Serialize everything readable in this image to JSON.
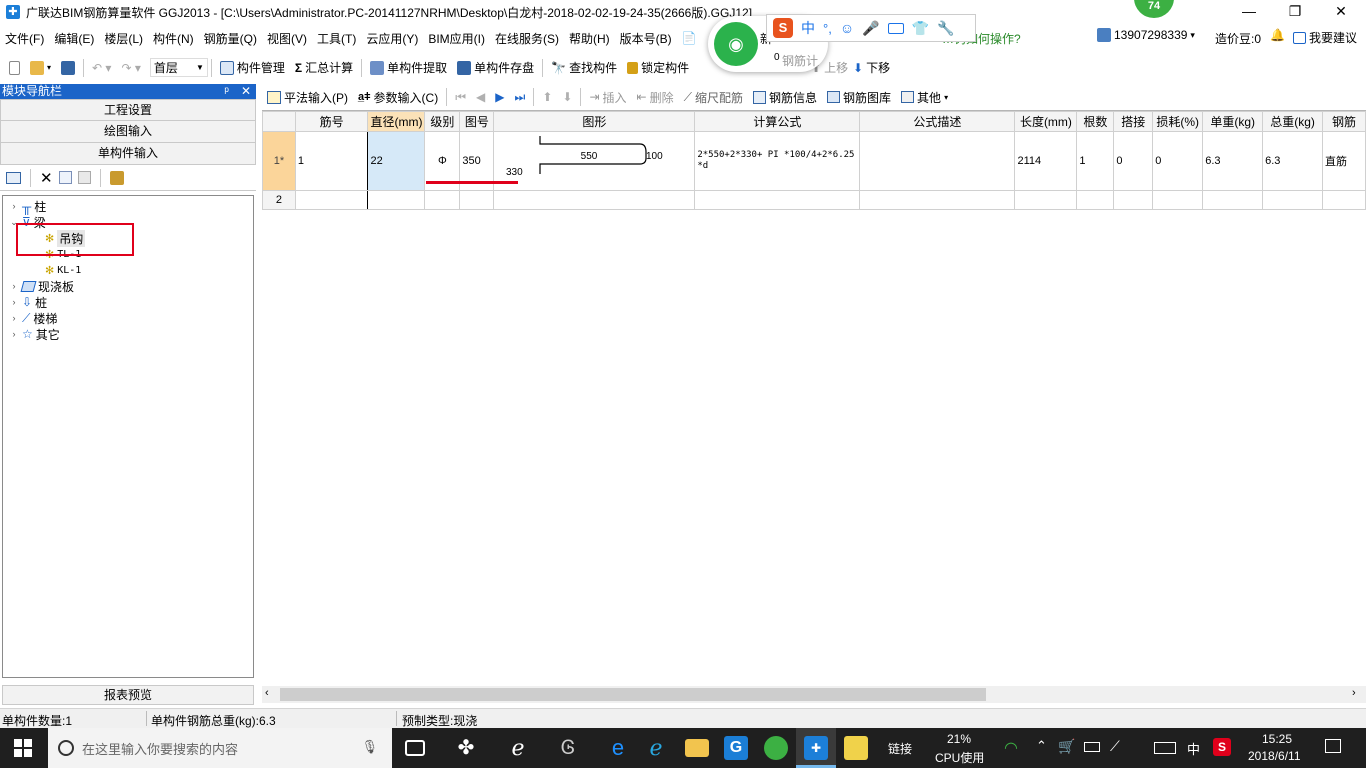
{
  "window": {
    "title": "广联达BIM钢筋算量软件 GGJ2013 - [C:\\Users\\Administrator.PC-20141127NRHM\\Desktop\\白龙村-2018-02-02-19-24-35(2666版).GGJ12]",
    "badge": "74"
  },
  "menu": [
    "文件(F)",
    "编辑(E)",
    "楼层(L)",
    "构件(N)",
    "钢筋量(Q)",
    "视图(V)",
    "工具(T)",
    "云应用(Y)",
    "BIM应用(I)",
    "在线服务(S)",
    "帮助(H)",
    "版本号(B)"
  ],
  "menu_right": {
    "question": "…钩如何操作?",
    "phone": "13907298339",
    "cost_beans": "造价豆:0",
    "suggest": "我要建议"
  },
  "toolbar": {
    "floor": "首层",
    "component_manage": "构件管理",
    "sum_calc": "汇总计算",
    "single_extract": "单构件提取",
    "single_save": "单构件存盘",
    "find_component": "查找构件",
    "lock_component": "锁定构件",
    "move_up": "上移",
    "move_down": "下移"
  },
  "nav": {
    "title": "模块导航栏",
    "sections": [
      "工程设置",
      "绘图输入",
      "单构件输入"
    ],
    "report": "报表预览",
    "tree": {
      "column": "柱",
      "beam": "梁",
      "beam_children": [
        "吊钩",
        "TL-1",
        "KL-1"
      ],
      "slab": "现浇板",
      "pile": "桩",
      "stair": "楼梯",
      "other": "其它"
    }
  },
  "grid_toolbar": {
    "flat_input": "平法输入(P)",
    "param_input": "参数输入(C)",
    "insert": "插入",
    "delete": "删除",
    "scale_rebar": "缩尺配筋",
    "rebar_info": "钢筋信息",
    "rebar_library": "钢筋图库",
    "other": "其他"
  },
  "grid": {
    "headers": [
      "筋号",
      "直径(mm)",
      "级别",
      "图号",
      "图形",
      "计算公式",
      "公式描述",
      "长度(mm)",
      "根数",
      "搭接",
      "损耗(%)",
      "单重(kg)",
      "总重(kg)",
      "钢筋"
    ],
    "rows": [
      {
        "index": "1*",
        "bar_no": "1",
        "diameter": "22",
        "grade": "Φ",
        "shape_no": "350",
        "shape": {
          "top": "550",
          "right": "100",
          "bottom": "330"
        },
        "formula": "2*550+2*330+ PI *100/4+2*6.25*d",
        "description": "",
        "length": "2114",
        "count": "1",
        "lap": "0",
        "loss": "0",
        "unit_weight": "6.3",
        "total_weight": "6.3",
        "rebar_type": "直筋"
      },
      {
        "index": "2"
      }
    ]
  },
  "status": {
    "count": "单构件数量:1",
    "total_weight": "单构件钢筋总重(kg):6.3",
    "prefab": "预制类型:现浇"
  },
  "popup": {
    "new_label": "新",
    "wifi_count": "0",
    "toolbar_partial": "钢筋计"
  },
  "taskbar": {
    "search_placeholder": "在这里输入你要搜索的内容",
    "link": "链接",
    "cpu_percent": "21%",
    "cpu_label": "CPU使用",
    "ime": "中",
    "time": "15:25",
    "date": "2018/6/11"
  },
  "colors": {
    "accent_blue": "#1b64c8",
    "highlight_red": "#e0001b",
    "selected_cell": "#d6e9f8",
    "row_header_selected": "#fbd59a"
  }
}
